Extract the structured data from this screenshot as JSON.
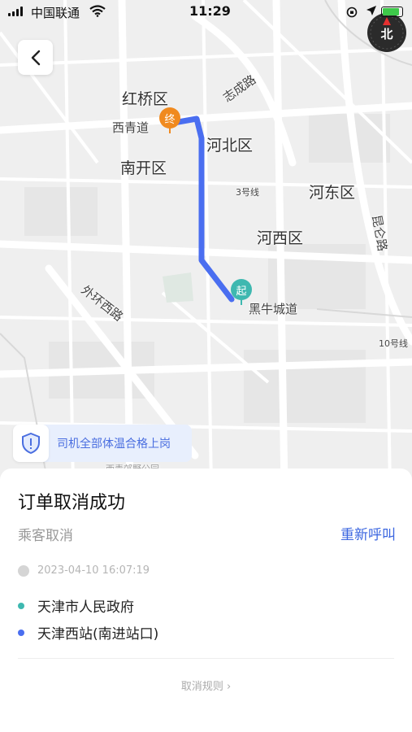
{
  "status_bar": {
    "carrier": "中国联通",
    "time": "11:29"
  },
  "compass": {
    "label": "北"
  },
  "map": {
    "labels": {
      "hongqiao": "红桥区",
      "xiqingdao": "西青道",
      "hebei": "河北区",
      "nankai": "南开区",
      "zhicheng": "志成路",
      "line3": "3号线",
      "hedong": "河东区",
      "hexi": "河西区",
      "kunlun": "昆仑路",
      "waihuan": "外环西路",
      "heiniu": "黑牛城道",
      "line10": "10号线",
      "park_partial": "西青郊野公园"
    },
    "pins": {
      "start": "起",
      "end": "终"
    }
  },
  "notice": {
    "text": "司机全部体温合格上岗"
  },
  "order": {
    "title": "订单取消成功",
    "subtitle": "乘客取消",
    "recall_label": "重新呼叫",
    "time": "2023-04-10 16:07:19",
    "origin": "天津市人民政府",
    "destination": "天津西站(南进站口)",
    "rules_label": "取消规则 ›"
  },
  "colors": {
    "route": "#4a6ef0",
    "origin_dot": "#3eb8b0",
    "destination_dot": "#4a6ef0",
    "end_pin": "#f08a1f",
    "accent": "#3b66e0"
  }
}
